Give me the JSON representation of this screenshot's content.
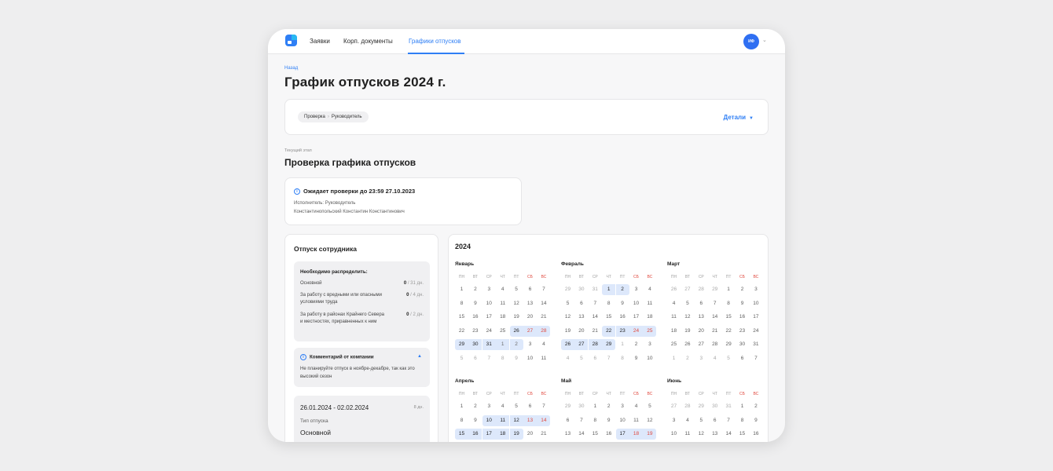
{
  "nav": {
    "items": [
      {
        "label": "Заявки"
      },
      {
        "label": "Корп. документы"
      },
      {
        "label": "Графики отпусков"
      }
    ],
    "avatar_initials": "ИФ"
  },
  "page": {
    "back": "Назад",
    "title": "График отпусков 2024 г."
  },
  "breadcrumb": {
    "steps": [
      "Проверка",
      "Руководитель"
    ],
    "details": "Детали"
  },
  "stage": {
    "label": "Текущий этап",
    "title": "Проверка графика отпусков",
    "status": "Ожидает проверки до 23:59 27.10.2023",
    "executor": "Исполнитель: Руководитель",
    "executor_name": "Константинопольский Константин Константинович"
  },
  "employee": {
    "title": "Отпуск сотрудника",
    "distribute": {
      "heading": "Необходимо распределить:",
      "rows": [
        {
          "label": "Основной",
          "used": "0",
          "total": " / 31 дн."
        },
        {
          "label": "За работу с вредными или опасными условиями труда",
          "used": "0",
          "total": " / 4 дн."
        },
        {
          "label": "За работу в районах Крайнего Севера и местностях, приравненных к ним",
          "used": "0",
          "total": " / 2 дн."
        }
      ]
    },
    "comment": {
      "heading": "Комментарий от компании",
      "text": "Не планируйте отпуск в ноябре-декабре, так как это высокий сезон"
    },
    "vacation": {
      "period": "26.01.2024 - 02.02.2024",
      "days": "8 дн.",
      "type_label": "Тип отпуска",
      "type_value": "Основной"
    }
  },
  "calendar": {
    "year": "2024",
    "weekdays": [
      "ПН",
      "ВТ",
      "СР",
      "ЧТ",
      "ПТ",
      "СБ",
      "ВС"
    ],
    "months": [
      {
        "name": "Январь",
        "weeks": [
          [
            "1",
            "2",
            "3",
            "4",
            "5",
            "6",
            "7"
          ],
          [
            "8",
            "9",
            "10",
            "11",
            "12",
            "13",
            "14"
          ],
          [
            "15",
            "16",
            "17",
            "18",
            "19",
            "20",
            "21"
          ],
          [
            "22",
            "23",
            "24",
            "25",
            "26",
            "27",
            "28"
          ],
          [
            "29",
            "30",
            "31",
            "1",
            "2",
            "3",
            "4"
          ],
          [
            "5",
            "6",
            "7",
            "8",
            "9",
            "10",
            "11"
          ]
        ],
        "first_out": 31,
        "selected": [
          [
            3,
            4
          ],
          [
            3,
            5
          ],
          [
            3,
            6
          ],
          [
            4,
            0
          ],
          [
            4,
            1
          ],
          [
            4,
            2
          ],
          [
            4,
            3
          ],
          [
            4,
            4
          ]
        ]
      },
      {
        "name": "Февраль",
        "weeks": [
          [
            "29",
            "30",
            "31",
            "1",
            "2",
            "3",
            "4"
          ],
          [
            "5",
            "6",
            "7",
            "8",
            "9",
            "10",
            "11"
          ],
          [
            "12",
            "13",
            "14",
            "15",
            "16",
            "17",
            "18"
          ],
          [
            "19",
            "20",
            "21",
            "22",
            "23",
            "24",
            "25"
          ],
          [
            "26",
            "27",
            "28",
            "29",
            "1",
            "2",
            "3"
          ],
          [
            "4",
            "5",
            "6",
            "7",
            "8",
            "9",
            "10"
          ]
        ],
        "selected": [
          [
            0,
            3
          ],
          [
            0,
            4
          ],
          [
            3,
            3
          ],
          [
            3,
            4
          ],
          [
            3,
            5
          ],
          [
            3,
            6
          ],
          [
            4,
            0
          ],
          [
            4,
            1
          ],
          [
            4,
            2
          ],
          [
            4,
            3
          ]
        ]
      },
      {
        "name": "Март",
        "weeks": [
          [
            "26",
            "27",
            "28",
            "29",
            "1",
            "2",
            "3"
          ],
          [
            "4",
            "5",
            "6",
            "7",
            "8",
            "9",
            "10"
          ],
          [
            "11",
            "12",
            "13",
            "14",
            "15",
            "16",
            "17"
          ],
          [
            "18",
            "19",
            "20",
            "21",
            "22",
            "23",
            "24"
          ],
          [
            "25",
            "26",
            "27",
            "28",
            "29",
            "30",
            "31"
          ],
          [
            "1",
            "2",
            "3",
            "4",
            "5",
            "6",
            "7"
          ]
        ],
        "selected": []
      },
      {
        "name": "Апрель",
        "weeks": [
          [
            "1",
            "2",
            "3",
            "4",
            "5",
            "6",
            "7"
          ],
          [
            "8",
            "9",
            "10",
            "11",
            "12",
            "13",
            "14"
          ],
          [
            "15",
            "16",
            "17",
            "18",
            "19",
            "20",
            "21"
          ]
        ],
        "selected": [
          [
            1,
            2
          ],
          [
            1,
            3
          ],
          [
            1,
            4
          ],
          [
            1,
            5
          ],
          [
            1,
            6
          ],
          [
            2,
            0
          ],
          [
            2,
            1
          ],
          [
            2,
            2
          ],
          [
            2,
            3
          ],
          [
            2,
            4
          ]
        ]
      },
      {
        "name": "Май",
        "weeks": [
          [
            "29",
            "30",
            "1",
            "2",
            "3",
            "4",
            "5"
          ],
          [
            "6",
            "7",
            "8",
            "9",
            "10",
            "11",
            "12"
          ],
          [
            "13",
            "14",
            "15",
            "16",
            "17",
            "18",
            "19"
          ]
        ],
        "selected": [
          [
            2,
            4
          ],
          [
            2,
            5
          ],
          [
            2,
            6
          ]
        ]
      },
      {
        "name": "Июнь",
        "weeks": [
          [
            "27",
            "28",
            "29",
            "30",
            "31",
            "1",
            "2"
          ],
          [
            "3",
            "4",
            "5",
            "6",
            "7",
            "8",
            "9"
          ],
          [
            "10",
            "11",
            "12",
            "13",
            "14",
            "15",
            "16"
          ]
        ],
        "selected": []
      }
    ]
  }
}
